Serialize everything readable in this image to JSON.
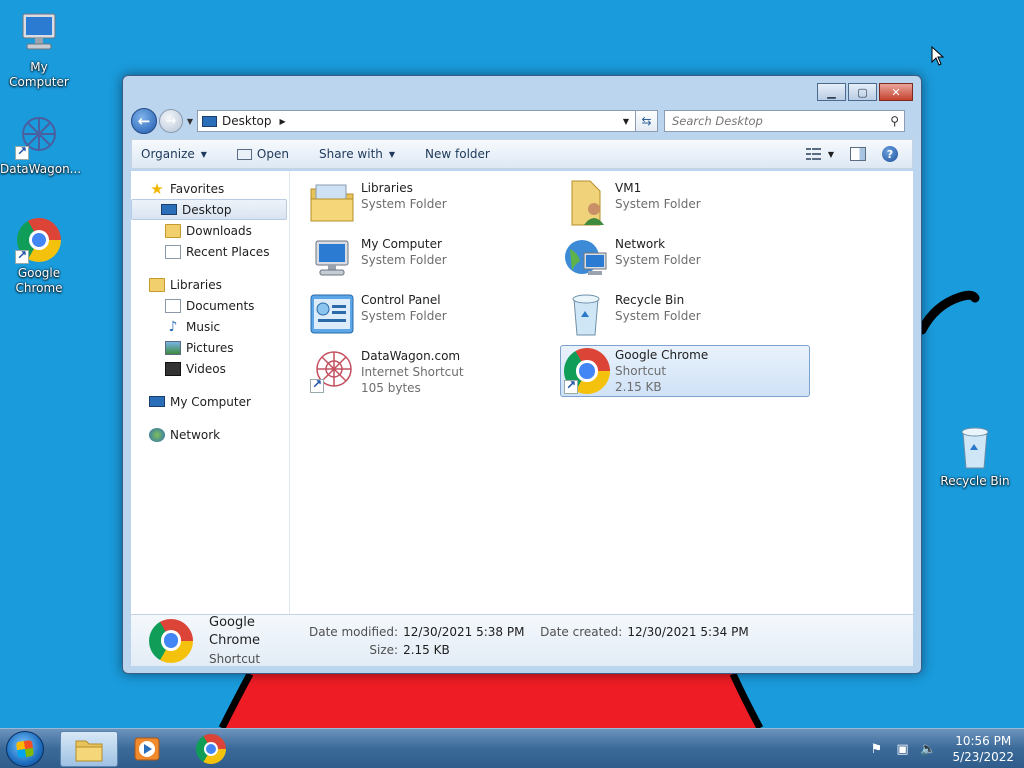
{
  "colors": {
    "desktop": "#1a9bdc",
    "selection": "#cfe2f7",
    "chrome_red": "#db4437",
    "chrome_yellow": "#f4c20d",
    "chrome_green": "#0f9d58",
    "chrome_blue": "#4285f4"
  },
  "desktop_icons": [
    {
      "label": "My Computer",
      "icon": "computer-icon"
    },
    {
      "label": "DataWagon...",
      "icon": "datawagon-shortcut-icon"
    },
    {
      "label": "Google Chrome",
      "icon": "chrome-shortcut-icon"
    },
    {
      "label": "Recycle Bin",
      "icon": "recycle-bin-icon"
    }
  ],
  "window": {
    "address": {
      "location": "Desktop"
    },
    "search": {
      "placeholder": "Search Desktop"
    },
    "toolbar": {
      "organize": "Organize",
      "open": "Open",
      "share_with": "Share with",
      "new_folder": "New folder"
    },
    "nav": {
      "favorites": "Favorites",
      "desktop": "Desktop",
      "downloads": "Downloads",
      "recent_places": "Recent Places",
      "libraries": "Libraries",
      "documents": "Documents",
      "music": "Music",
      "pictures": "Pictures",
      "videos": "Videos",
      "my_computer": "My Computer",
      "network": "Network"
    },
    "items": [
      {
        "name": "Libraries",
        "type": "System Folder",
        "size": ""
      },
      {
        "name": "VM1",
        "type": "System Folder",
        "size": ""
      },
      {
        "name": "My Computer",
        "type": "System Folder",
        "size": ""
      },
      {
        "name": "Network",
        "type": "System Folder",
        "size": ""
      },
      {
        "name": "Control Panel",
        "type": "System Folder",
        "size": ""
      },
      {
        "name": "Recycle Bin",
        "type": "System Folder",
        "size": ""
      },
      {
        "name": "DataWagon.com",
        "type": "Internet Shortcut",
        "size": "105 bytes"
      },
      {
        "name": "Google Chrome",
        "type": "Shortcut",
        "size": "2.15 KB"
      }
    ],
    "details": {
      "name": "Google Chrome",
      "type": "Shortcut",
      "modified_label": "Date modified:",
      "modified_value": "12/30/2021 5:38 PM",
      "size_label": "Size:",
      "size_value": "2.15 KB",
      "created_label": "Date created:",
      "created_value": "12/30/2021 5:34 PM"
    }
  },
  "taskbar": {
    "time": "10:56 PM",
    "date": "5/23/2022"
  }
}
